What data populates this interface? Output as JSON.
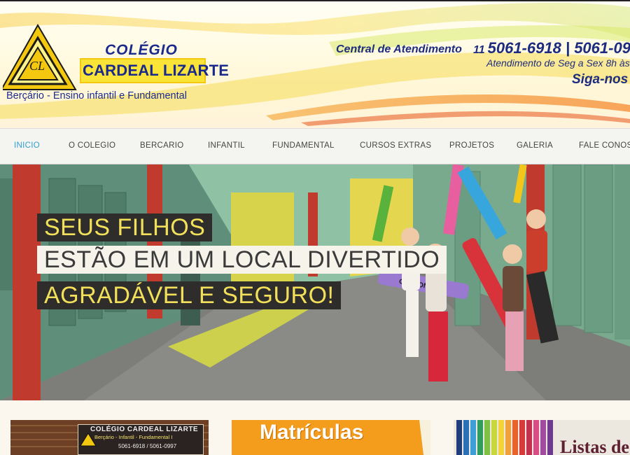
{
  "header": {
    "logo": {
      "colegio": "COLÉGIO",
      "name": "CARDEAL LIZARTE",
      "monogram": "CL",
      "tagline": "Berçário - Ensino infantil e Fundamental"
    },
    "contact": {
      "label": "Central de Atendimento",
      "phone_prefix": "11",
      "phones": "5061-6918 | 5061-09",
      "hours": "Atendimento de Seg a Sex 8h às",
      "social": "Siga-nos"
    }
  },
  "nav": {
    "items": [
      {
        "label": "INICIO",
        "active": true
      },
      {
        "label": "O COLEGIO"
      },
      {
        "label": "BERCARIO"
      },
      {
        "label": "INFANTIL"
      },
      {
        "label": "FUNDAMENTAL"
      },
      {
        "label": "CURSOS EXTRAS"
      },
      {
        "label": "PROJETOS"
      },
      {
        "label": "GALERIA"
      },
      {
        "label": "FALE CONOSCO"
      }
    ]
  },
  "hero": {
    "line1": "SEUS FILHOS",
    "line2": "ESTÃO EM UM LOCAL DIVERTIDO",
    "line3": "AGRADÁVEL E SEGURO!",
    "crayon_label": "CRAYON"
  },
  "cards": {
    "card1": {
      "sign_title": "COLÉGIO CARDEAL LIZARTE",
      "sign_sub": "Berçário - Infantil - Fundamental I",
      "sign_phone": "5061-6918 / 5061-0997"
    },
    "card2": {
      "title": "Matrículas"
    },
    "card3": {
      "title": "Listas de"
    }
  },
  "colors": {
    "accent_blue": "#1d2c7f",
    "nav_active": "#2f9fd0",
    "logo_yellow": "#f9e437",
    "hero_yellow_text": "#f2e05a"
  }
}
